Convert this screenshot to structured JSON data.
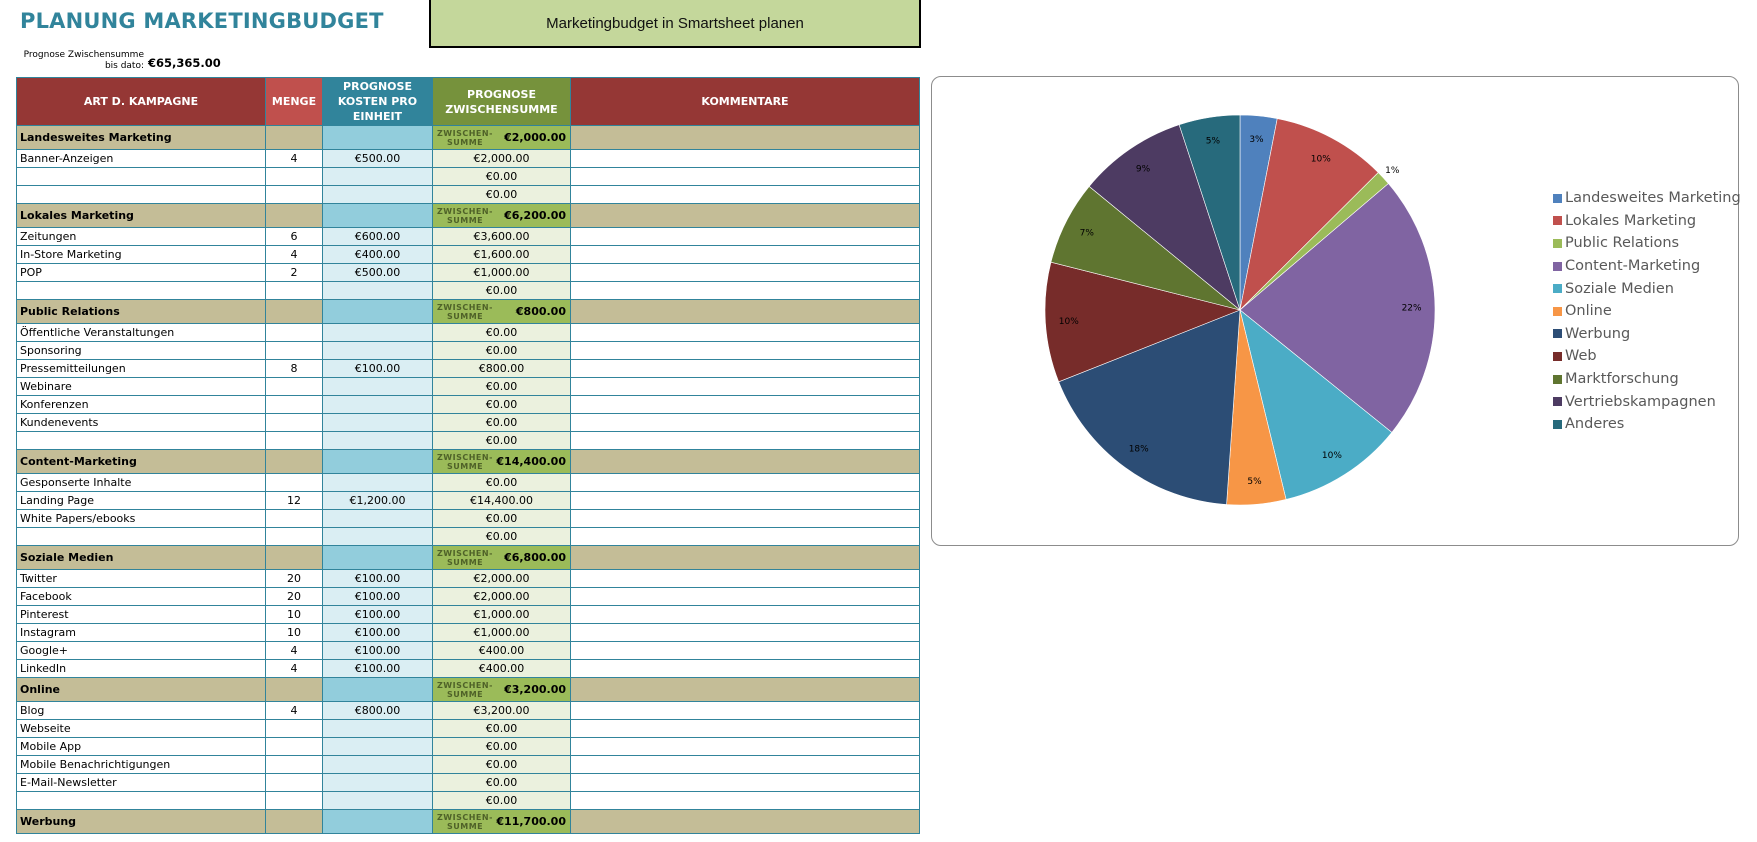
{
  "title": "PLANUNG MARKETINGBUDGET",
  "smartsheet_button": "Marketingbudget in Smartsheet planen",
  "forecast": {
    "label": "Prognose Zwischensumme bis dato:",
    "value": "€65,365.00"
  },
  "table": {
    "headers": [
      "ART D. KAMPAGNE",
      "MENGE",
      "PROGNOSE KOSTEN PRO EINHEIT",
      "PROGNOSE ZWISCHENSUMME",
      "KOMMENTARE"
    ],
    "subtotal_label_1": "ZWISCHEN-",
    "subtotal_label_2": "SUMME",
    "sections": [
      {
        "name": "Landesweites Marketing",
        "subtotal": "€2,000.00",
        "rows": [
          {
            "item": "Banner-Anzeigen",
            "qty": "4",
            "cost": "€500.00",
            "sub": "€2,000.00"
          },
          {
            "item": "",
            "qty": "",
            "cost": "",
            "sub": "€0.00"
          },
          {
            "item": "",
            "qty": "",
            "cost": "",
            "sub": "€0.00"
          }
        ]
      },
      {
        "name": "Lokales Marketing",
        "subtotal": "€6,200.00",
        "rows": [
          {
            "item": "Zeitungen",
            "qty": "6",
            "cost": "€600.00",
            "sub": "€3,600.00"
          },
          {
            "item": "In-Store Marketing",
            "qty": "4",
            "cost": "€400.00",
            "sub": "€1,600.00"
          },
          {
            "item": "POP",
            "qty": "2",
            "cost": "€500.00",
            "sub": "€1,000.00"
          },
          {
            "item": "",
            "qty": "",
            "cost": "",
            "sub": "€0.00"
          }
        ]
      },
      {
        "name": "Public Relations",
        "subtotal": "€800.00",
        "rows": [
          {
            "item": "Öffentliche Veranstaltungen",
            "qty": "",
            "cost": "",
            "sub": "€0.00"
          },
          {
            "item": "Sponsoring",
            "qty": "",
            "cost": "",
            "sub": "€0.00"
          },
          {
            "item": "Pressemitteilungen",
            "qty": "8",
            "cost": "€100.00",
            "sub": "€800.00"
          },
          {
            "item": "Webinare",
            "qty": "",
            "cost": "",
            "sub": "€0.00"
          },
          {
            "item": "Konferenzen",
            "qty": "",
            "cost": "",
            "sub": "€0.00"
          },
          {
            "item": "Kundenevents",
            "qty": "",
            "cost": "",
            "sub": "€0.00"
          },
          {
            "item": "",
            "qty": "",
            "cost": "",
            "sub": "€0.00"
          }
        ]
      },
      {
        "name": "Content-Marketing",
        "subtotal": "€14,400.00",
        "rows": [
          {
            "item": "Gesponserte Inhalte",
            "qty": "",
            "cost": "",
            "sub": "€0.00"
          },
          {
            "item": "Landing Page",
            "qty": "12",
            "cost": "€1,200.00",
            "sub": "€14,400.00"
          },
          {
            "item": "White Papers/ebooks",
            "qty": "",
            "cost": "",
            "sub": "€0.00"
          },
          {
            "item": "",
            "qty": "",
            "cost": "",
            "sub": "€0.00"
          }
        ]
      },
      {
        "name": "Soziale Medien",
        "subtotal": "€6,800.00",
        "rows": [
          {
            "item": "Twitter",
            "qty": "20",
            "cost": "€100.00",
            "sub": "€2,000.00"
          },
          {
            "item": "Facebook",
            "qty": "20",
            "cost": "€100.00",
            "sub": "€2,000.00"
          },
          {
            "item": "Pinterest",
            "qty": "10",
            "cost": "€100.00",
            "sub": "€1,000.00"
          },
          {
            "item": "Instagram",
            "qty": "10",
            "cost": "€100.00",
            "sub": "€1,000.00"
          },
          {
            "item": "Google+",
            "qty": "4",
            "cost": "€100.00",
            "sub": "€400.00"
          },
          {
            "item": "LinkedIn",
            "qty": "4",
            "cost": "€100.00",
            "sub": "€400.00"
          }
        ]
      },
      {
        "name": "Online",
        "subtotal": "€3,200.00",
        "rows": [
          {
            "item": "Blog",
            "qty": "4",
            "cost": "€800.00",
            "sub": "€3,200.00"
          },
          {
            "item": "Webseite",
            "qty": "",
            "cost": "",
            "sub": "€0.00"
          },
          {
            "item": "Mobile App",
            "qty": "",
            "cost": "",
            "sub": "€0.00"
          },
          {
            "item": "Mobile Benachrichtigungen",
            "qty": "",
            "cost": "",
            "sub": "€0.00"
          },
          {
            "item": "E-Mail-Newsletter",
            "qty": "",
            "cost": "",
            "sub": "€0.00"
          },
          {
            "item": "",
            "qty": "",
            "cost": "",
            "sub": "€0.00"
          }
        ]
      },
      {
        "name": "Werbung",
        "subtotal": "€11,700.00",
        "rows": []
      }
    ]
  },
  "chart_data": {
    "type": "pie",
    "title": "",
    "legend_position": "right",
    "categories": [
      "Landesweites Marketing",
      "Lokales Marketing",
      "Public Relations",
      "Content-Marketing",
      "Soziale Medien",
      "Online",
      "Werbung",
      "Web",
      "Marktforschung",
      "Vertriebskampagnen",
      "Anderes"
    ],
    "values": [
      2000,
      6200,
      800,
      14400,
      6800,
      3200,
      11700,
      6500,
      4565,
      5900,
      3300
    ],
    "labels": [
      "3%",
      "10%",
      "1%",
      "22%",
      "10%",
      "5%",
      "18%",
      "10%",
      "7%",
      "9%",
      "5%"
    ],
    "colors": [
      "#4f81bd",
      "#c0504d",
      "#9bbb59",
      "#8064a2",
      "#4bacc6",
      "#f79646",
      "#2c4d75",
      "#772c2a",
      "#5f7530",
      "#4d3b62",
      "#276a7c"
    ]
  }
}
